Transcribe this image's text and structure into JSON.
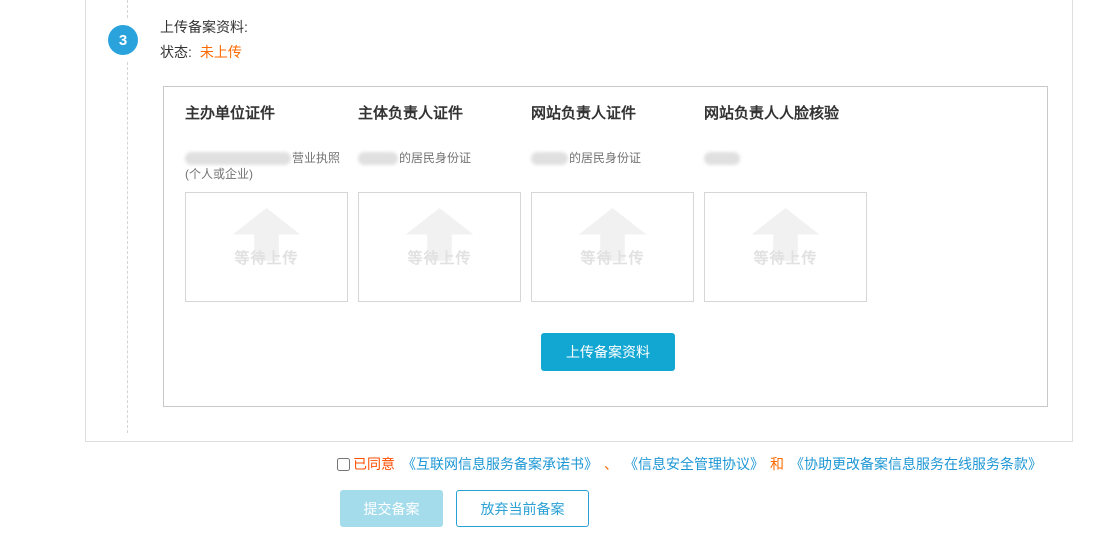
{
  "colors": {
    "step_circle_blue": "#2aa3dd",
    "status_orange": "#ff6a00",
    "agree_red_orange": "#ff4d00",
    "link_blue": "#1e97d4",
    "primary_button_cyan": "#12a7d3",
    "disabled_button_blue": "#a5dcec",
    "outline_button_blue": "#2aa0d4",
    "placeholder_gray": "#e1e1e1"
  },
  "step": {
    "number": "3",
    "title": "上传备案资料:",
    "status_label": "状态:",
    "status_value": "未上传"
  },
  "panel": {
    "columns": [
      {
        "header": "主办单位证件",
        "desc_redacted": true,
        "desc_suffix": "营业执照",
        "desc_line2": "(个人或企业)",
        "placeholder": "等待上传"
      },
      {
        "header": "主体负责人证件",
        "desc_redacted": true,
        "desc_suffix": "的居民身份证",
        "desc_line2": "",
        "placeholder": "等待上传"
      },
      {
        "header": "网站负责人证件",
        "desc_redacted": true,
        "desc_suffix": "的居民身份证",
        "desc_line2": "",
        "placeholder": "等待上传"
      },
      {
        "header": "网站负责人人脸核验",
        "desc_redacted": true,
        "desc_suffix": "",
        "desc_line2": "",
        "placeholder": "等待上传"
      }
    ],
    "upload_button": "上传备案资料"
  },
  "agreement": {
    "checkbox_checked": false,
    "agree_label": "已同意",
    "links": [
      "《互联网信息服务备案承诺书》",
      "《信息安全管理协议》",
      "《协助更改备案信息服务在线服务条款》"
    ],
    "separators": [
      "、",
      "和"
    ]
  },
  "footer": {
    "submit_label": "提交备案",
    "abandon_label": "放弃当前备案"
  }
}
